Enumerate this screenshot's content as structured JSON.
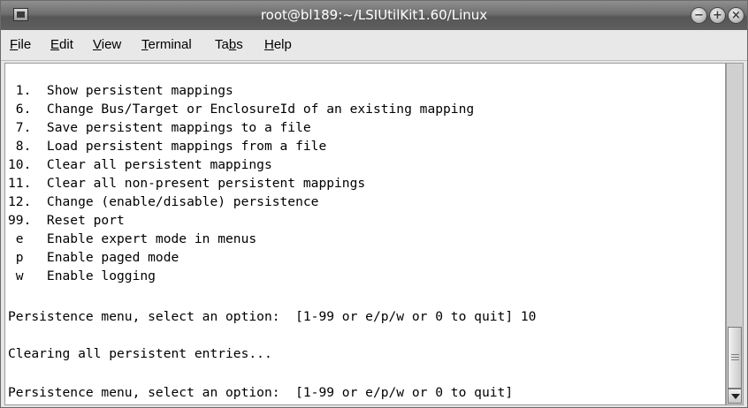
{
  "window": {
    "title": "root@bl189:~/LSIUtilKit1.60/Linux",
    "icons": [
      "terminal-app-icon",
      "minimize-icon",
      "maximize-icon",
      "close-icon"
    ]
  },
  "menu": [
    {
      "pre": "",
      "u": "F",
      "post": "ile"
    },
    {
      "pre": "",
      "u": "E",
      "post": "dit"
    },
    {
      "pre": "",
      "u": "V",
      "post": "iew"
    },
    {
      "pre": "",
      "u": "T",
      "post": "erminal"
    },
    {
      "pre": "Ta",
      "u": "b",
      "post": "s"
    },
    {
      "pre": "",
      "u": "H",
      "post": "elp"
    }
  ],
  "terminal": {
    "lines": [
      " 1.  Show persistent mappings",
      " 6.  Change Bus/Target or EnclosureId of an existing mapping",
      " 7.  Save persistent mappings to a file",
      " 8.  Load persistent mappings from a file",
      "10.  Clear all persistent mappings",
      "11.  Clear all non-present persistent mappings",
      "12.  Change (enable/disable) persistence",
      "99.  Reset port",
      " e   Enable expert mode in menus",
      " p   Enable paged mode",
      " w   Enable logging",
      "",
      "Persistence menu, select an option:  [1-99 or e/p/w or 0 to quit] 10",
      "",
      "Clearing all persistent entries...",
      "",
      "Persistence menu, select an option:  [1-99 or e/p/w or 0 to quit]"
    ]
  }
}
